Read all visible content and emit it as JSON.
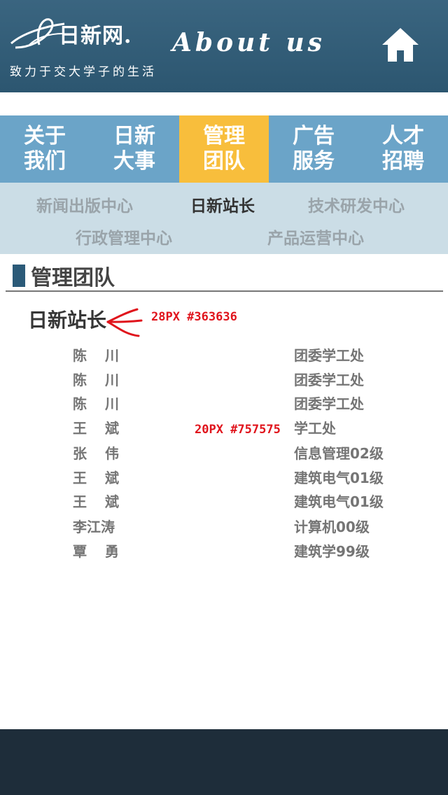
{
  "header": {
    "logo_text": "日新网.",
    "tagline": "致力于交大学子的生活",
    "title": "About us",
    "home_icon": "home-icon"
  },
  "nav": {
    "items": [
      {
        "label": "关于我们",
        "active": false
      },
      {
        "label": "日新大事",
        "active": false
      },
      {
        "label": "管理团队",
        "active": true
      },
      {
        "label": "广告服务",
        "active": false
      },
      {
        "label": "人才招聘",
        "active": false
      }
    ],
    "active_color": "#f8be3c",
    "bar_color": "#6ba4c8"
  },
  "subnav": {
    "items": [
      {
        "label": "新闻出版中心",
        "active": false
      },
      {
        "label": "日新站长",
        "active": true
      },
      {
        "label": "技术研发中心",
        "active": false
      },
      {
        "label": "行政管理中心",
        "active": false
      },
      {
        "label": "产品运营中心",
        "active": false
      }
    ]
  },
  "section": {
    "title": "管理团队",
    "accent_color": "#2b5a78"
  },
  "group": {
    "title": "日新站长"
  },
  "annotations": {
    "title_spec": "28PX   #363636",
    "list_spec": "20PX #757575"
  },
  "members": [
    {
      "name": "陈川",
      "dept": "团委学工处"
    },
    {
      "name": "陈川",
      "dept": "团委学工处"
    },
    {
      "name": "陈川",
      "dept": "团委学工处"
    },
    {
      "name": "王斌",
      "dept": "学工处"
    },
    {
      "name": "张伟",
      "dept": "信息管理02级"
    },
    {
      "name": "王斌",
      "dept": "建筑电气01级"
    },
    {
      "name": "王斌",
      "dept": "建筑电气01级"
    },
    {
      "name": "李江涛",
      "dept": "计算机00级"
    },
    {
      "name": "覃勇",
      "dept": "建筑学99级"
    }
  ]
}
